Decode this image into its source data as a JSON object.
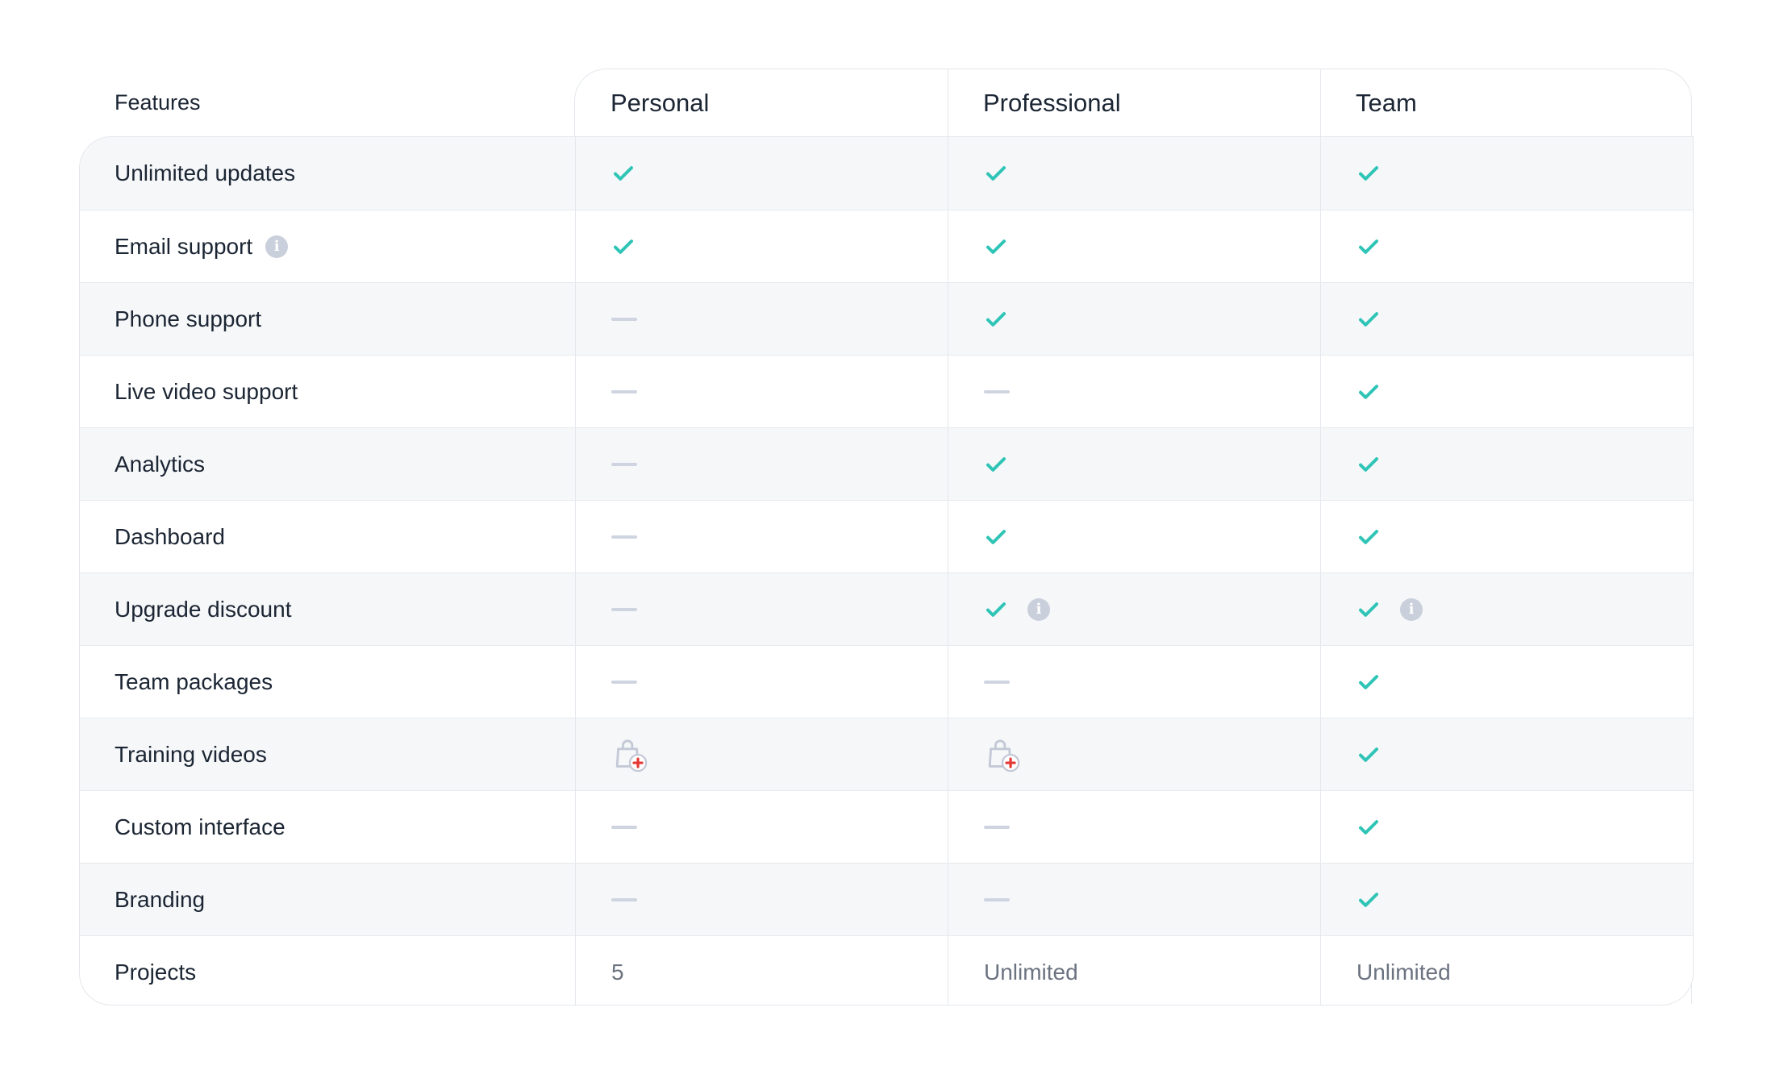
{
  "header": {
    "features_label": "Features",
    "plans": [
      "Personal",
      "Professional",
      "Team"
    ]
  },
  "colors": {
    "check": "#2ec4b6",
    "dash": "#cfd5e0",
    "info": "#c9cfdb",
    "alt_row": "#f6f7f9",
    "badge_plus": "#e53935"
  },
  "rows": [
    {
      "feature": "Unlimited updates",
      "cells": [
        "check",
        "check",
        "check"
      ]
    },
    {
      "feature": "Email support",
      "info": true,
      "cells": [
        "check",
        "check",
        "check"
      ]
    },
    {
      "feature": "Phone support",
      "cells": [
        "dash",
        "check",
        "check"
      ]
    },
    {
      "feature": "Live video support",
      "cells": [
        "dash",
        "dash",
        "check"
      ]
    },
    {
      "feature": "Analytics",
      "cells": [
        "dash",
        "check",
        "check"
      ]
    },
    {
      "feature": "Dashboard",
      "cells": [
        "dash",
        "check",
        "check"
      ]
    },
    {
      "feature": "Upgrade discount",
      "cells": [
        "dash",
        "check+info",
        "check+info"
      ]
    },
    {
      "feature": "Team packages",
      "cells": [
        "dash",
        "dash",
        "check"
      ]
    },
    {
      "feature": "Training videos",
      "cells": [
        "bag-add-icon",
        "bag-add-icon",
        "check"
      ]
    },
    {
      "feature": "Custom interface",
      "cells": [
        "dash",
        "dash",
        "check"
      ]
    },
    {
      "feature": "Branding",
      "cells": [
        "dash",
        "dash",
        "check"
      ]
    },
    {
      "feature": "Projects",
      "cells": [
        "5",
        "Unlimited",
        "Unlimited"
      ]
    }
  ]
}
